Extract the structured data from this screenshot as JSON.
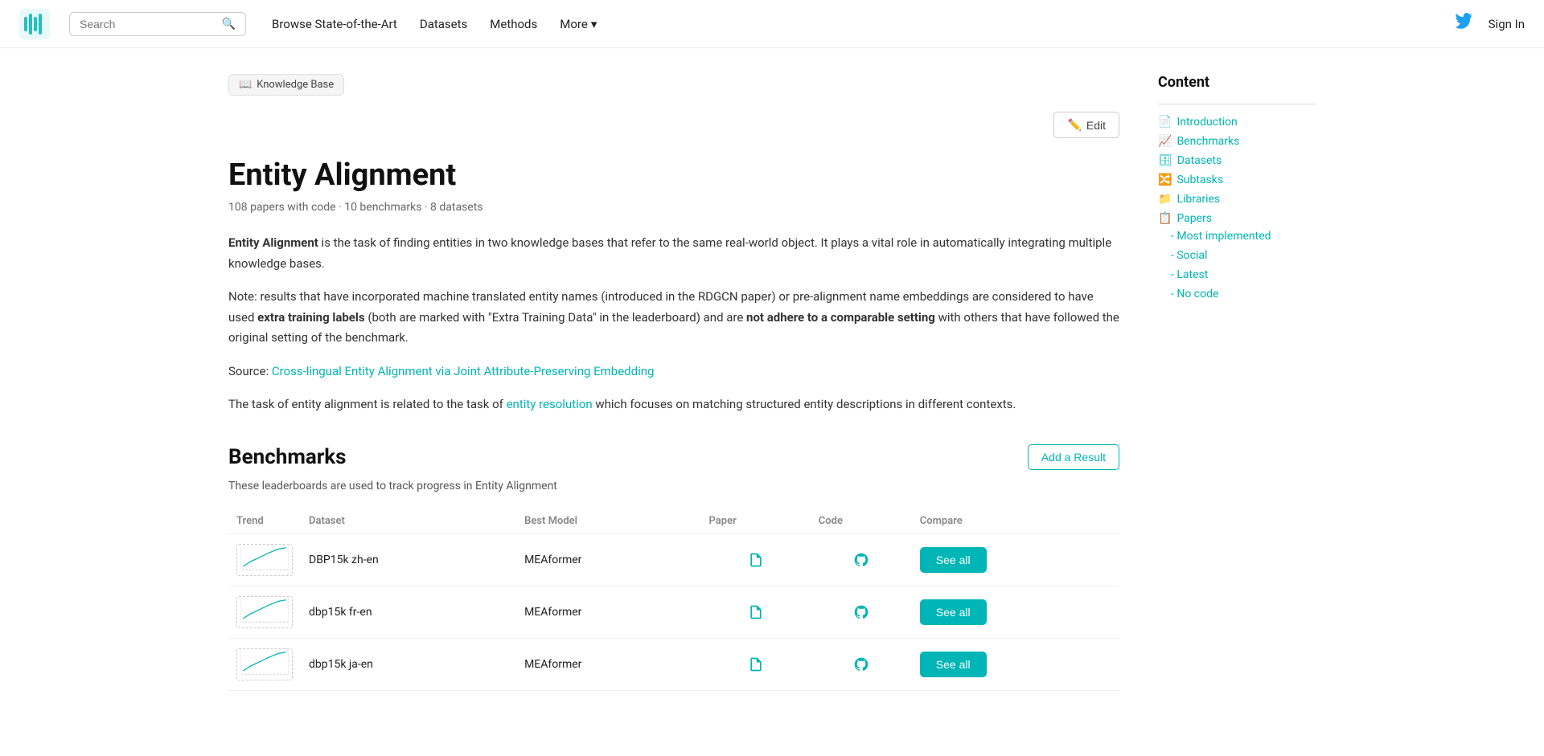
{
  "navbar": {
    "logo_alt": "Papers With Code logo",
    "search_placeholder": "Search",
    "nav_links": [
      {
        "label": "Browse State-of-the-Art",
        "id": "browse-sota"
      },
      {
        "label": "Datasets",
        "id": "datasets"
      },
      {
        "label": "Methods",
        "id": "methods"
      },
      {
        "label": "More",
        "id": "more",
        "has_arrow": true
      }
    ],
    "sign_in": "Sign In"
  },
  "breadcrumb": {
    "icon": "📄",
    "label": "Knowledge Base"
  },
  "main": {
    "title": "Entity Alignment",
    "meta": "108 papers with code · 10 benchmarks · 8 datasets",
    "edit_label": "Edit",
    "intro_p1_bold": "Entity Alignment",
    "intro_p1_rest": " is the task of finding entities in two knowledge bases that refer to the same real-world object. It plays a vital role in automatically integrating multiple knowledge bases.",
    "intro_p2": "Note: results that have incorporated machine translated entity names (introduced in the RDGCN paper) or pre-alignment name embeddings are considered to have used ",
    "intro_p2_bold": "extra training labels",
    "intro_p2_rest": " (both are marked with \"Extra Training Data\" in the leaderboard) and are ",
    "intro_p2_bold2": "not adhere to a comparable setting",
    "intro_p2_rest2": " with others that have followed the original setting of the benchmark.",
    "source_prefix": "Source: ",
    "source_link_text": "Cross-lingual Entity Alignment via Joint Attribute-Preserving Embedding",
    "source_link_href": "#",
    "task_text_pre": "The task of entity alignment is related to the task of ",
    "task_link": "entity resolution",
    "task_text_post": " which focuses on matching structured entity descriptions in different contexts.",
    "benchmarks_section": {
      "title": "Benchmarks",
      "add_result_label": "Add a Result",
      "description": "These leaderboards are used to track progress in Entity Alignment",
      "columns": [
        "Trend",
        "Dataset",
        "Best Model",
        "Paper",
        "Code",
        "Compare"
      ],
      "rows": [
        {
          "trend": "up",
          "dataset": "DBP15k zh-en",
          "best_model": "MEAformer",
          "see_all": "See all"
        },
        {
          "trend": "up",
          "dataset": "dbp15k fr-en",
          "best_model": "MEAformer",
          "see_all": "See all"
        },
        {
          "trend": "up",
          "dataset": "dbp15k ja-en",
          "best_model": "MEAformer",
          "see_all": "See all"
        }
      ]
    }
  },
  "sidebar": {
    "content_title": "Content",
    "nav_items": [
      {
        "label": "Introduction",
        "icon": "doc"
      },
      {
        "label": "Benchmarks",
        "icon": "chart"
      },
      {
        "label": "Datasets",
        "icon": "database"
      },
      {
        "label": "Subtasks",
        "icon": "subtask"
      },
      {
        "label": "Libraries",
        "icon": "lib"
      },
      {
        "label": "Papers",
        "icon": "paper"
      }
    ],
    "sub_items": [
      {
        "label": "- Most implemented"
      },
      {
        "label": "- Social"
      },
      {
        "label": "- Latest"
      },
      {
        "label": "- No code"
      }
    ]
  },
  "colors": {
    "teal": "#00b5b5",
    "teal_dark": "#009a9a",
    "text_primary": "#111",
    "text_secondary": "#666"
  }
}
